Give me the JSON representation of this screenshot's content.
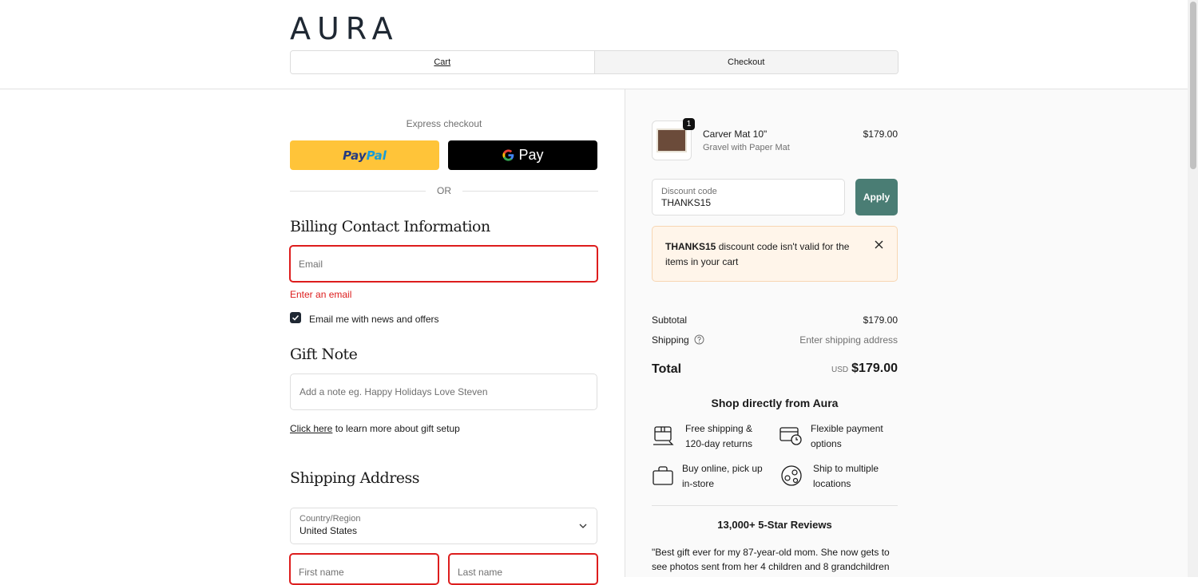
{
  "brand": {
    "logo": "AURA"
  },
  "nav": {
    "tabs": [
      {
        "label": "Cart"
      },
      {
        "label": "Checkout"
      }
    ]
  },
  "express": {
    "label": "Express checkout",
    "paypal_part1": "Pay",
    "paypal_part2": "Pal",
    "gpay_label": "Pay",
    "or": "OR"
  },
  "billing": {
    "title": "Billing Contact Information",
    "email_placeholder": "Email",
    "email_error": "Enter an email",
    "newsletter_label": "Email me with news and offers",
    "newsletter_checked": true
  },
  "gift": {
    "title": "Gift Note",
    "note_placeholder": "Add a note eg. Happy Holidays Love Steven",
    "learn_link": "Click here",
    "learn_rest": " to learn more about gift setup"
  },
  "shipping": {
    "title": "Shipping Address",
    "country_label": "Country/Region",
    "country_value": "United States",
    "first_name_placeholder": "First name",
    "last_name_placeholder": "Last name"
  },
  "summary": {
    "item": {
      "name": "Carver Mat 10\"",
      "variant": "Gravel with Paper Mat",
      "price": "$179.00",
      "quantity": "1"
    },
    "discount": {
      "label": "Discount code",
      "value": "THANKS15",
      "apply_label": "Apply"
    },
    "alert": {
      "code": "THANKS15",
      "message": " discount code isn't valid for the items in your cart"
    },
    "subtotal_label": "Subtotal",
    "subtotal_value": "$179.00",
    "shipping_label": "Shipping",
    "shipping_value": "Enter shipping address",
    "total_label": "Total",
    "total_currency": "USD",
    "total_value": "$179.00"
  },
  "perks": {
    "title": "Shop directly from Aura",
    "items": [
      {
        "line1": "Free shipping &",
        "line2": "120-day returns",
        "icon": "box-return-icon"
      },
      {
        "line1": "Flexible payment",
        "line2": "options",
        "icon": "card-clock-icon"
      },
      {
        "line1": "Buy online, pick up",
        "line2": "in-store",
        "icon": "bag-icon"
      },
      {
        "line1": "Ship to multiple",
        "line2": "locations",
        "icon": "globe-pin-icon"
      }
    ]
  },
  "reviews": {
    "title": "13,000+ 5-Star Reviews",
    "quote_line1": "\"Best gift ever for my 87-year-old mom. She now gets to",
    "quote_line2": "see photos sent from her 4 children and 8 grandchildren"
  },
  "colors": {
    "accent": "#4a7d74",
    "error": "#dd1d1d",
    "paypal": "#ffc439",
    "dark": "#1f2833"
  }
}
